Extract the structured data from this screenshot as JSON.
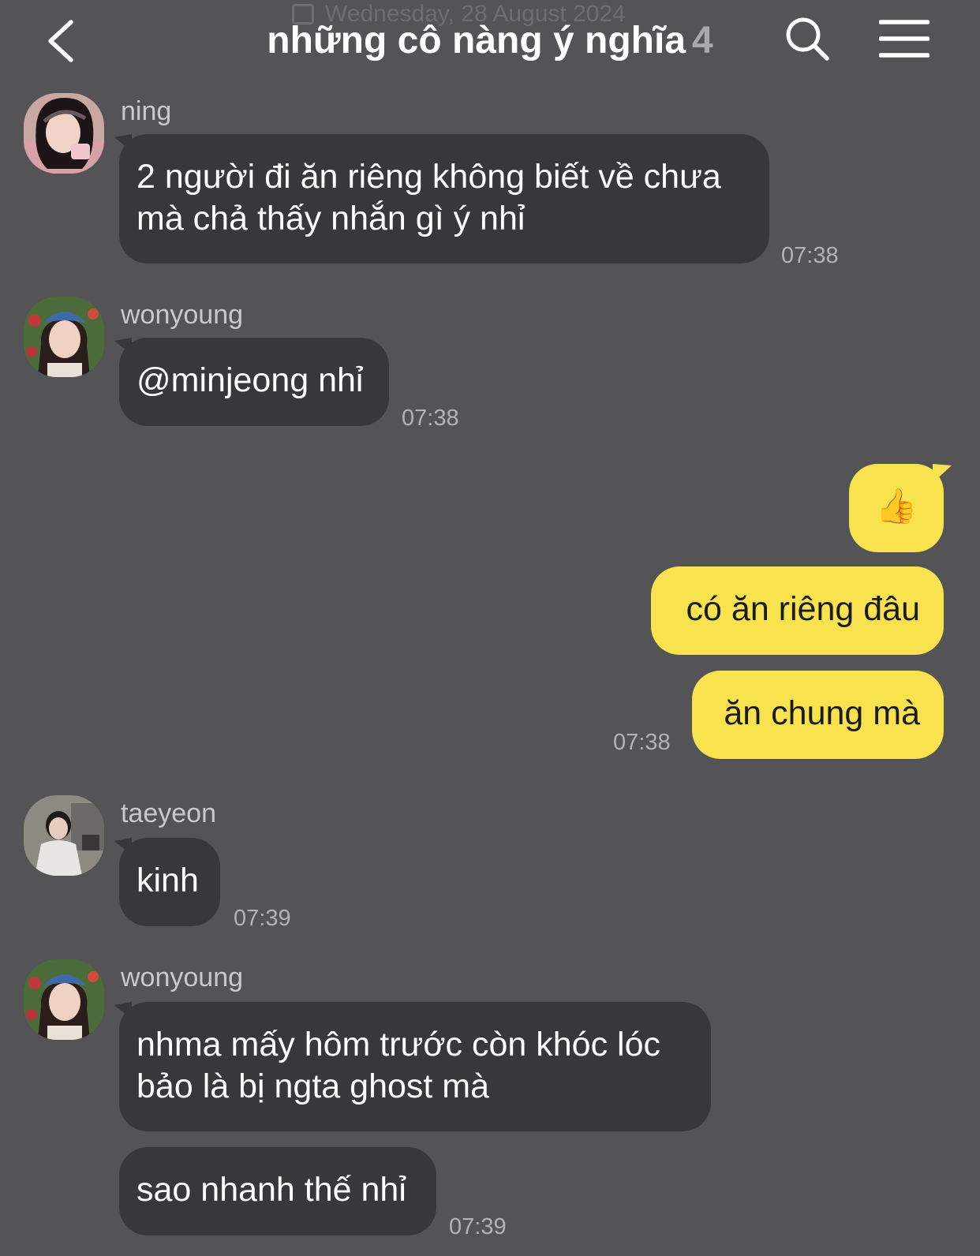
{
  "header": {
    "date": "Wednesday, 28 August 2024",
    "title": "những cô nàng ý nghĩa",
    "member_count": "4",
    "icons": {
      "back": "chevron-left-icon",
      "search": "search-icon",
      "menu": "hamburger-menu-icon",
      "date": "calendar-icon"
    }
  },
  "colors": {
    "background": "#545355",
    "incoming_bubble": "#38373a",
    "outgoing_bubble": "#f8e34f"
  },
  "messages": [
    {
      "sender": "ning",
      "lines": [
        "2 người đi ăn riêng không biết về chưa",
        "mà chả thấy nhắn gì ý nhỉ"
      ],
      "time": "07:38"
    },
    {
      "sender": "wonyoung",
      "lines": [
        "@minjeong nhỉ"
      ],
      "time": "07:38"
    },
    {
      "sender": "me",
      "text": "👍"
    },
    {
      "sender": "me",
      "text": "có ăn riêng đâu"
    },
    {
      "sender": "me",
      "text": "ăn chung mà",
      "time": "07:38"
    },
    {
      "sender": "taeyeon",
      "lines": [
        "kinh"
      ],
      "time": "07:39"
    },
    {
      "sender": "wonyoung",
      "lines": [
        "nhma mấy hôm trước còn khóc lóc",
        "bảo là bị ngta ghost mà"
      ]
    },
    {
      "sender": "wonyoung",
      "lines": [
        "sao nhanh thế nhỉ"
      ],
      "time": "07:39"
    }
  ]
}
